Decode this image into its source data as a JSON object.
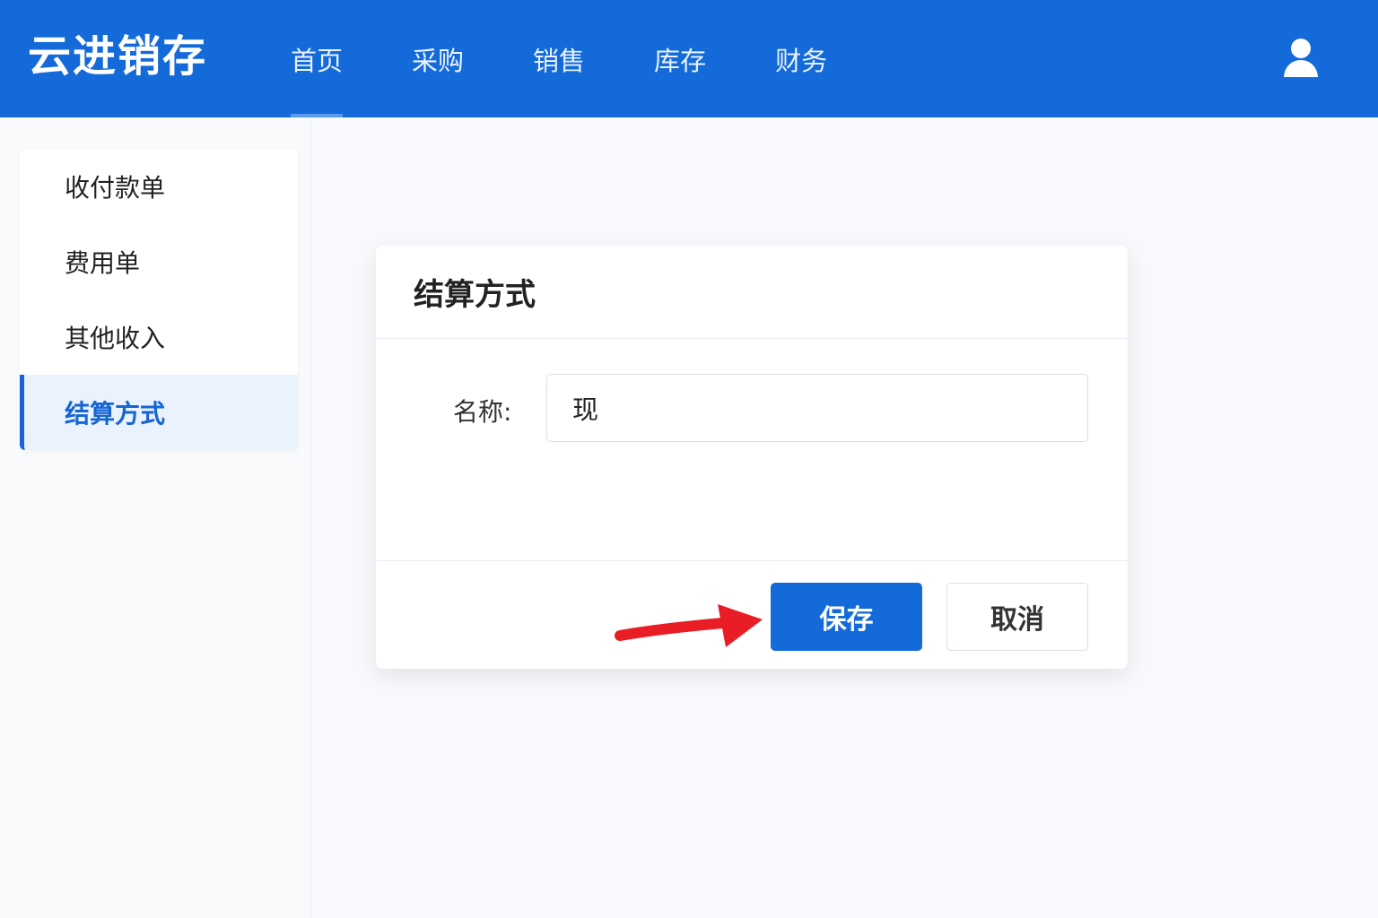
{
  "app": {
    "brand": "云进销存"
  },
  "nav": {
    "items": [
      {
        "label": "首页",
        "active": true
      },
      {
        "label": "采购",
        "active": false
      },
      {
        "label": "销售",
        "active": false
      },
      {
        "label": "库存",
        "active": false
      },
      {
        "label": "财务",
        "active": false
      }
    ]
  },
  "sidebar": {
    "items": [
      {
        "label": "收付款单",
        "active": false
      },
      {
        "label": "费用单",
        "active": false
      },
      {
        "label": "其他收入",
        "active": false
      },
      {
        "label": "结算方式",
        "active": true
      }
    ]
  },
  "dialog": {
    "title": "结算方式",
    "field_label": "名称:",
    "field_value": "现",
    "save_label": "保存",
    "cancel_label": "取消"
  },
  "icons": {
    "user": "user-icon",
    "arrow": "arrow-right-icon"
  },
  "colors": {
    "brand": "#136ad8",
    "active_sidebar_bg": "#eaf2fd",
    "annotation_arrow": "#e81d25"
  }
}
